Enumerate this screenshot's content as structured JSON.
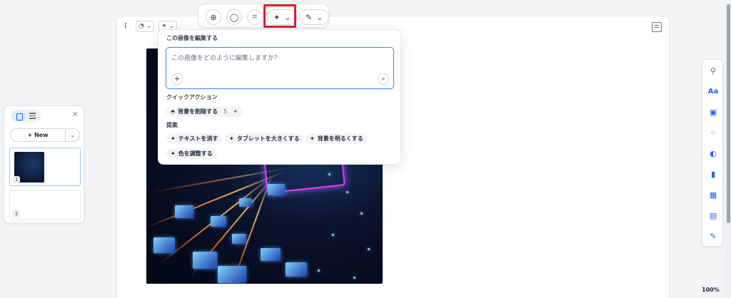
{
  "toolbar": {
    "zoom_icon": "zoom-in-icon",
    "comment_icon": "comment-icon",
    "crop_icon": "crop-icon",
    "ai_edit_icon": "sparkle-icon",
    "edit_icon": "edit-icon"
  },
  "popover": {
    "title": "この画像を編集する",
    "prompt_placeholder": "この画像をどのように編集しますか？",
    "add_label": "+",
    "quick_actions_label": "クイックアクション",
    "quick_actions": [
      {
        "label": "背景を削除する",
        "count": "5"
      }
    ],
    "suggestions_label": "提案",
    "suggestions": [
      {
        "label": "テキストを消す"
      },
      {
        "label": "タブレットを大きくする"
      },
      {
        "label": "背景を明るくする"
      },
      {
        "label": "色を調整する"
      }
    ]
  },
  "pages_panel": {
    "new_label": "New",
    "close_label": "×",
    "pages": [
      {
        "number": "1"
      },
      {
        "number": "2"
      }
    ]
  },
  "rightbar": {
    "items": [
      "search-icon",
      "text-icon",
      "image-icon",
      "elements-icon",
      "toggle-icon",
      "chart-icon",
      "table-icon",
      "layout-icon",
      "draw-icon"
    ]
  },
  "zoom": "100%",
  "colors": {
    "accent": "#2563eb",
    "highlight": "#e11d26"
  }
}
